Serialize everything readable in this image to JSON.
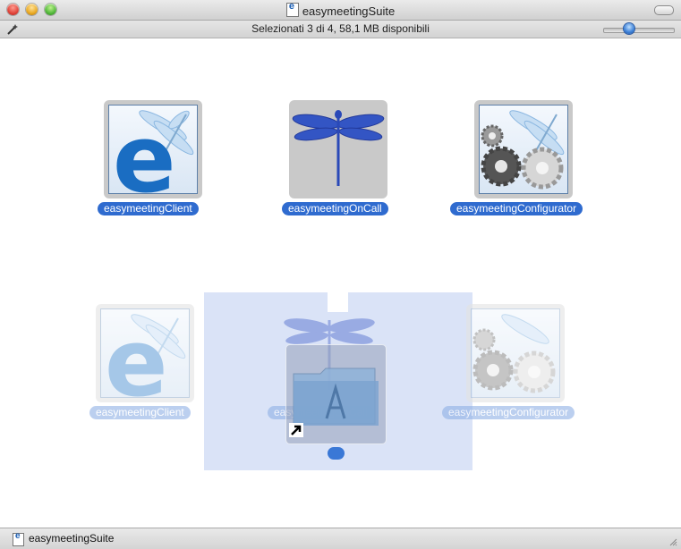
{
  "window": {
    "title": "easymeetingSuite",
    "status_text": "Selezionati 3 di 4, 58,1 MB disponibili"
  },
  "items": [
    {
      "label": "easymeetingClient",
      "icon": "easymeeting-client-icon"
    },
    {
      "label": "easymeetingOnCall",
      "icon": "dragonfly-icon"
    },
    {
      "label": "easymeetingConfigurator",
      "icon": "gears-dragonfly-icon"
    }
  ],
  "drag_items": [
    {
      "label": "easymeetingClient"
    },
    {
      "label": "easymeetingOnCall"
    },
    {
      "label": "easymeetingConfigurator"
    }
  ],
  "path_bar": {
    "label": "easymeetingSuite"
  },
  "colors": {
    "selection_label": "#2f6bcf",
    "ghost_label": "#8fb0e5",
    "drag_region": "#cddaf4"
  }
}
